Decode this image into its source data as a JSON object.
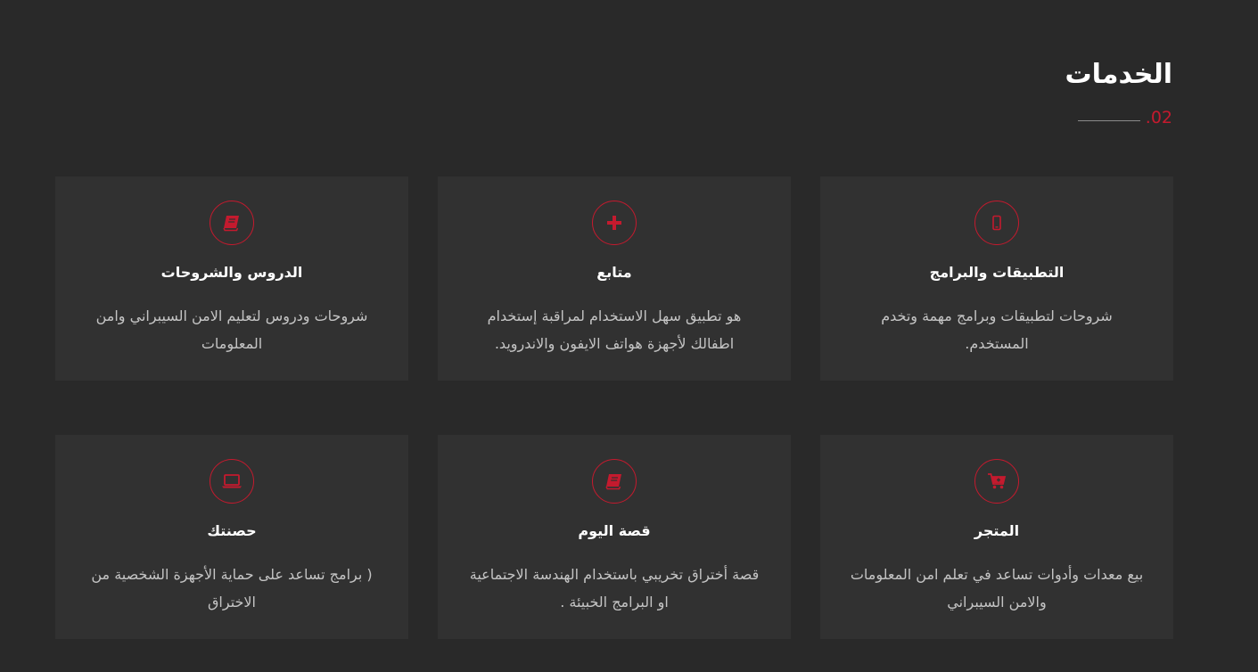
{
  "section": {
    "title": "الخدمات",
    "number": ".02"
  },
  "colors": {
    "background": "#292929",
    "card": "#313131",
    "accent": "#c41a2e",
    "title": "#ffffff",
    "text": "#c4c4c4"
  },
  "services": [
    {
      "icon": "mobile-icon",
      "title": "التطبيقات والبرامج",
      "description": "شروحات لتطبيقات وبرامج مهمة وتخدم المستخدم."
    },
    {
      "icon": "plus-icon",
      "title": "متابع",
      "description": "هو تطبيق سهل الاستخدام لمراقبة إستخدام اطفالك لأجهزة هواتف الايفون والاندرويد."
    },
    {
      "icon": "book-icon",
      "title": "الدروس والشروحات",
      "description": "شروحات ودروس لتعليم الامن السيبراني وامن المعلومات"
    },
    {
      "icon": "cart-icon",
      "title": "المتجر",
      "description": "بيع معدات وأدوات تساعد في تعلم امن المعلومات والامن السيبراني"
    },
    {
      "icon": "book-icon",
      "title": "قصة اليوم",
      "description": "قصة أختراق تخريبي باستخدام الهندسة الاجتماعية او البرامج الخبيئة ."
    },
    {
      "icon": "laptop-icon",
      "title": "حصنتك",
      "description": "( برامج تساعد على حماية الأجهزة الشخصية من الاختراق"
    }
  ]
}
